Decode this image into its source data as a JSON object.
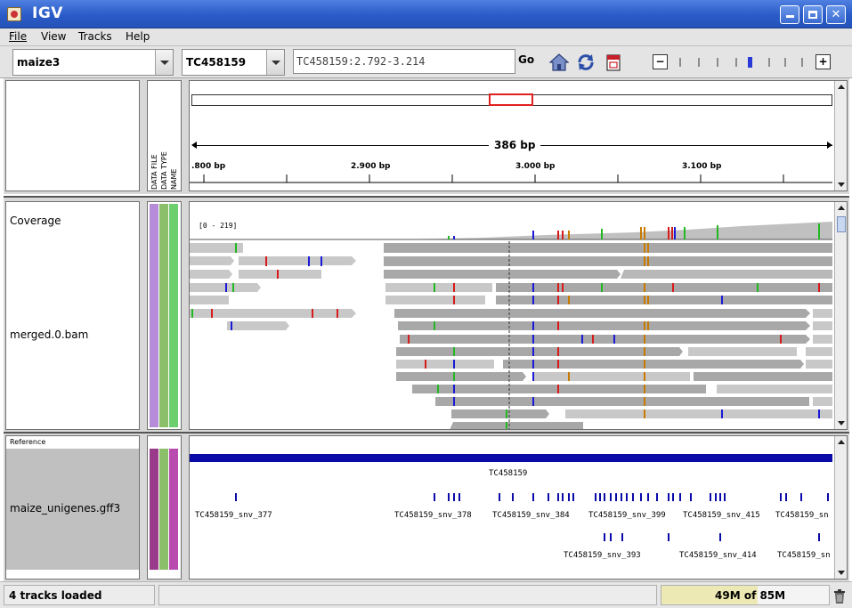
{
  "window": {
    "title": "IGV"
  },
  "menu": [
    "File",
    "View",
    "Tracks",
    "Help"
  ],
  "toolbar": {
    "genome": "maize3",
    "chromosome": "TC458159",
    "locus": "TC458159:2.792-3.214",
    "go_label": "Go",
    "zoom_minus": "−",
    "zoom_plus": "+"
  },
  "header_panel": {
    "attribute_labels": [
      "DATA FILE",
      "DATA TYPE",
      "NAME"
    ],
    "span_label": "386 bp",
    "ruler_ticks": [
      {
        "label": ".800 bp",
        "bp": 2800
      },
      {
        "label": "2.900 bp",
        "bp": 2900
      },
      {
        "label": "3.000 bp",
        "bp": 3000
      },
      {
        "label": "3.100 bp",
        "bp": 3100
      }
    ]
  },
  "data_panel": {
    "coverage_label": "Coverage",
    "bam_label": "merged.0.bam",
    "coverage_range": "[0 - 219]"
  },
  "feature_panel": {
    "reference_label": "Reference",
    "track_label": "maize_unigenes.gff3",
    "gene_label": "TC458159",
    "snv_labels_row1": [
      "TC458159_snv_377",
      "TC458159_snv_378",
      "TC458159_snv_384",
      "TC458159_snv_399",
      "TC458159_snv_415",
      "TC458159_sn"
    ],
    "snv_labels_row2": [
      "TC458159_snv_393",
      "TC458159_snv_414",
      "TC458159_sn"
    ]
  },
  "status": {
    "message": "4 tracks loaded",
    "memory": "49M of 85M",
    "memory_used_fraction": 0.576
  },
  "colors": {
    "title_bar": "#2a5bc8",
    "region_box": "#e02020",
    "gene_bar": "#0a0aa8",
    "read_fill": "#a8a8a8",
    "mismatch_A": "#22b822",
    "mismatch_C": "#1a1ad8",
    "mismatch_G": "#c87a00",
    "mismatch_T": "#d81a1a",
    "attr_data_file_1": "#b68cd8",
    "attr_data_type_1": "#8cbf6a",
    "attr_name_1": "#6ecf6e",
    "attr_data_file_2": "#9a3a8a",
    "attr_name_2": "#b84ab0"
  },
  "icons": [
    "home-icon",
    "refresh-icon",
    "roi-icon",
    "trash-icon"
  ]
}
